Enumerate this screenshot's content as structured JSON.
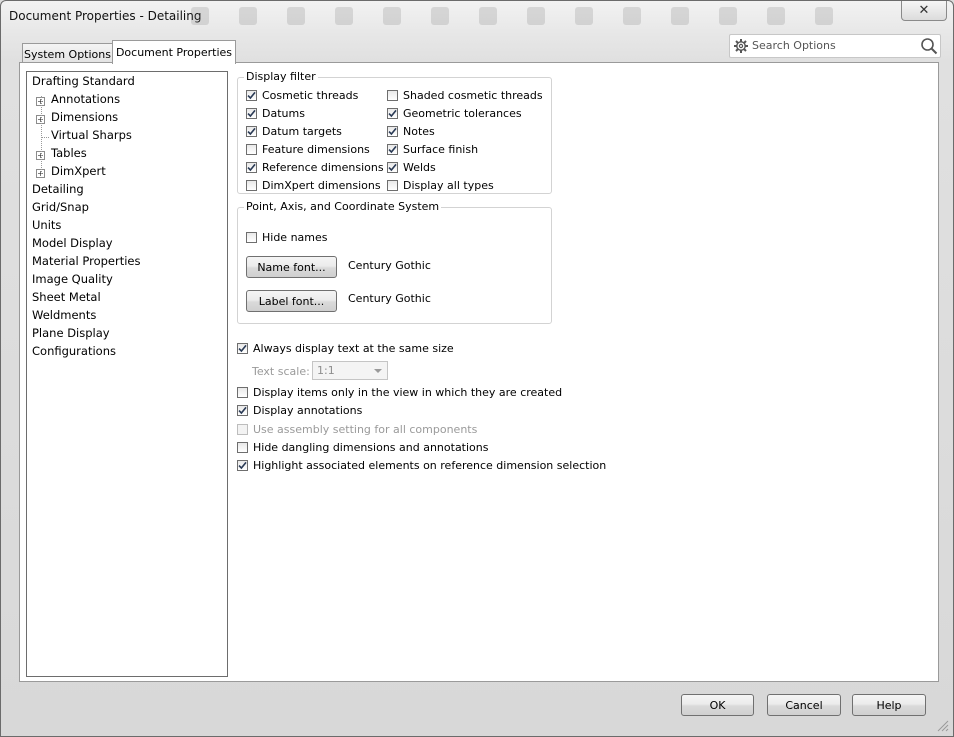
{
  "window": {
    "title": "Document Properties - Detailing",
    "close_label": "✕"
  },
  "tabs": [
    {
      "label": "System Options",
      "active": false
    },
    {
      "label": "Document Properties",
      "active": true
    }
  ],
  "search": {
    "placeholder": "Search Options",
    "icon": "magnifier-icon",
    "settings_icon": "gear-icon"
  },
  "tree": {
    "items": [
      {
        "label": "Drafting Standard",
        "level": 0,
        "expandable": false
      },
      {
        "label": "Annotations",
        "level": 1,
        "expandable": true
      },
      {
        "label": "Dimensions",
        "level": 1,
        "expandable": true
      },
      {
        "label": "Virtual Sharps",
        "level": 1,
        "expandable": false
      },
      {
        "label": "Tables",
        "level": 1,
        "expandable": true
      },
      {
        "label": "DimXpert",
        "level": 1,
        "expandable": true
      },
      {
        "label": "Detailing",
        "level": 0,
        "expandable": false,
        "selected": true
      },
      {
        "label": "Grid/Snap",
        "level": 0
      },
      {
        "label": "Units",
        "level": 0
      },
      {
        "label": "Model Display",
        "level": 0
      },
      {
        "label": "Material Properties",
        "level": 0
      },
      {
        "label": "Image Quality",
        "level": 0
      },
      {
        "label": "Sheet Metal",
        "level": 0
      },
      {
        "label": "Weldments",
        "level": 0
      },
      {
        "label": "Plane Display",
        "level": 0
      },
      {
        "label": "Configurations",
        "level": 0
      }
    ]
  },
  "display_filter": {
    "label": "Display filter",
    "left": [
      {
        "label": "Cosmetic threads",
        "checked": true
      },
      {
        "label": "Datums",
        "checked": true
      },
      {
        "label": "Datum targets",
        "checked": true
      },
      {
        "label": "Feature dimensions",
        "checked": false
      },
      {
        "label": "Reference dimensions",
        "checked": true
      },
      {
        "label": "DimXpert dimensions",
        "checked": false
      }
    ],
    "right": [
      {
        "label": "Shaded cosmetic threads",
        "checked": false
      },
      {
        "label": "Geometric tolerances",
        "checked": true
      },
      {
        "label": "Notes",
        "checked": true
      },
      {
        "label": "Surface finish",
        "checked": true
      },
      {
        "label": "Welds",
        "checked": true
      },
      {
        "label": "Display all types",
        "checked": false
      }
    ]
  },
  "point_axis": {
    "label": "Point, Axis, and Coordinate System",
    "hide_names": {
      "label": "Hide names",
      "checked": false
    },
    "name_font_button": "Name font...",
    "name_font_value": "Century Gothic",
    "label_font_button": "Label font...",
    "label_font_value": "Century Gothic"
  },
  "options": {
    "always_same_size": {
      "label": "Always display text at the same size",
      "checked": true
    },
    "text_scale_label": "Text scale:",
    "text_scale_value": "1:1",
    "display_only_in_view": {
      "label": "Display items only in the view in which they are created",
      "checked": false
    },
    "display_annotations": {
      "label": "Display annotations",
      "checked": true
    },
    "use_assembly_setting": {
      "label": "Use assembly setting for all components",
      "checked": false,
      "disabled": true
    },
    "hide_dangling": {
      "label": "Hide dangling dimensions and annotations",
      "checked": false
    },
    "highlight_associated": {
      "label": "Highlight associated elements on reference dimension selection",
      "checked": true
    }
  },
  "footer": {
    "ok": "OK",
    "cancel": "Cancel",
    "help": "Help"
  }
}
